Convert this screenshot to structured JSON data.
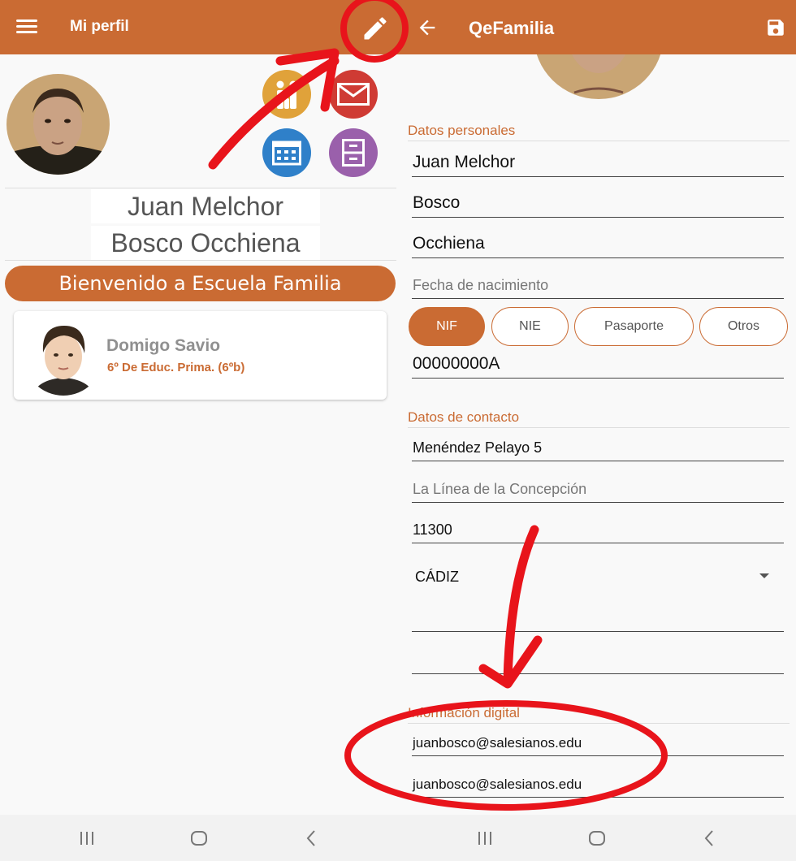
{
  "left": {
    "title": "Mi perfil",
    "name_line1": "Juan Melchor",
    "name_line2": "Bosco Occhiena",
    "welcome": "Bienvenido a Escuela Familia",
    "child": {
      "name": "Domigo Savio",
      "class": "6º De Educ. Prima. (6ºb)"
    }
  },
  "right": {
    "title": "QeFamilia",
    "personal": {
      "section_label": "Datos personales",
      "first_name": "Juan Melchor",
      "last_name1": "Bosco",
      "last_name2": "Occhiena",
      "birth_placeholder": "Fecha de nacimiento",
      "doc_types": [
        "NIF",
        "NIE",
        "Pasaporte",
        "Otros"
      ],
      "doc_number": "00000000A"
    },
    "contact": {
      "section_label": "Datos de contacto",
      "address": "Menéndez Pelayo 5",
      "city_placeholder": "La Línea de la Concepción",
      "postal_code": "11300",
      "province": "CÁDIZ"
    },
    "digital": {
      "section_label": "Información digital",
      "email1": "juanbosco@salesianos.edu",
      "email2": "juanbosco@salesianos.edu"
    }
  },
  "colors": {
    "primary": "#ca6b33",
    "family": "#e0a23a",
    "mail": "#cf3b34",
    "calendar": "#2f80c9",
    "files": "#9a60ab",
    "annotation": "#e8141b"
  },
  "icons": [
    "menu-icon",
    "pencil-icon",
    "back-arrow-icon",
    "save-icon",
    "family-icon",
    "mail-icon",
    "calendar-icon",
    "files-icon",
    "dropdown-arrow-icon",
    "recent-apps-icon",
    "home-icon",
    "back-icon"
  ]
}
